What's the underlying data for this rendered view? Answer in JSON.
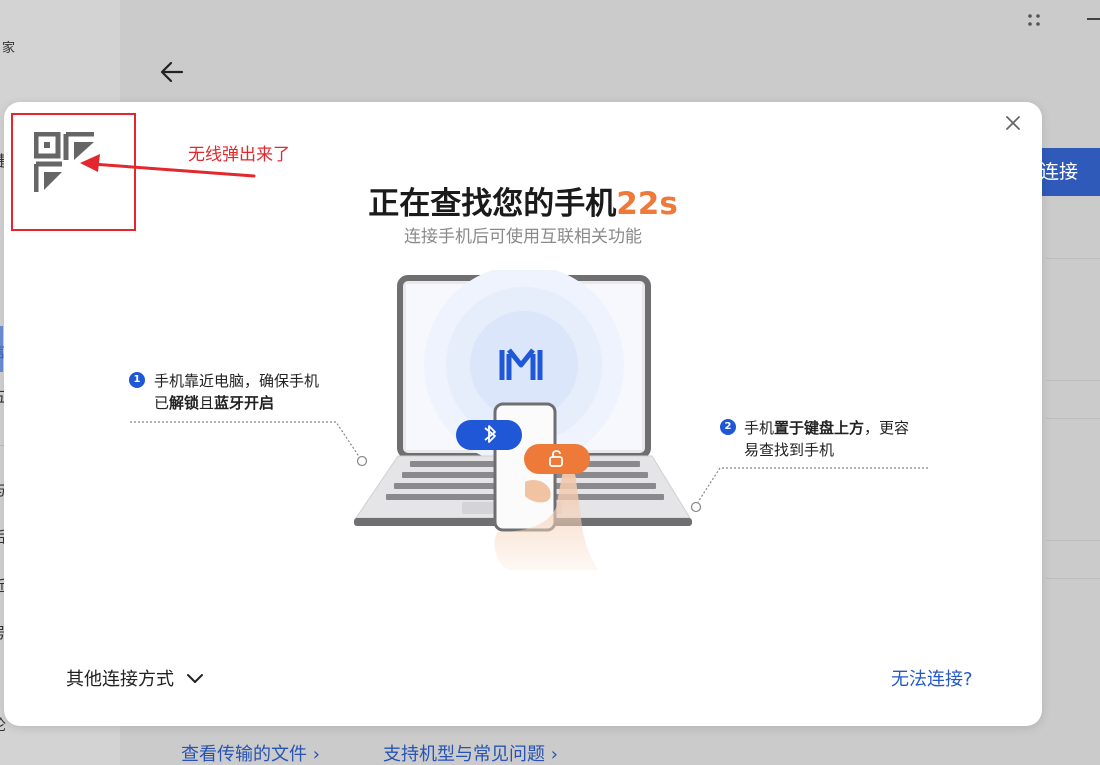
{
  "background": {
    "sidebar_fragments": [
      "家",
      "捷",
      "言",
      "五",
      "与",
      "后",
      "近",
      "号",
      "论"
    ],
    "blue_button_text": "连接",
    "links": [
      "查看传输的文件 ›",
      "支持机型与常见问题 ›"
    ]
  },
  "modal": {
    "title": "正在查找您的手机",
    "countdown": "22s",
    "subtitle": "连接手机后可使用互联相关功能",
    "step1": {
      "number": "1",
      "line1": "手机靠近电脑，确保手机",
      "line2_prefix": "已",
      "line2_bold1": "解锁",
      "line2_mid": "且",
      "line2_bold2": "蓝牙开启"
    },
    "step2": {
      "number": "2",
      "line1_prefix": "手机",
      "line1_bold": "置于键盘上方",
      "line1_suffix": "，更容",
      "line2": "易查找到手机"
    },
    "other_connection_label": "其他连接方式",
    "cant_connect_label": "无法连接?"
  },
  "annotation": {
    "text": "无线弹出来了"
  },
  "colors": {
    "accent_blue": "#1f57d6",
    "countdown_orange": "#ee7a3a",
    "annotation_red": "#e2282d"
  },
  "icons": {
    "close": "close-icon",
    "qr": "qr-code-icon",
    "back": "back-arrow-icon",
    "chevron": "chevron-down-icon",
    "bluetooth": "bluetooth-icon",
    "unlock": "unlock-icon"
  }
}
